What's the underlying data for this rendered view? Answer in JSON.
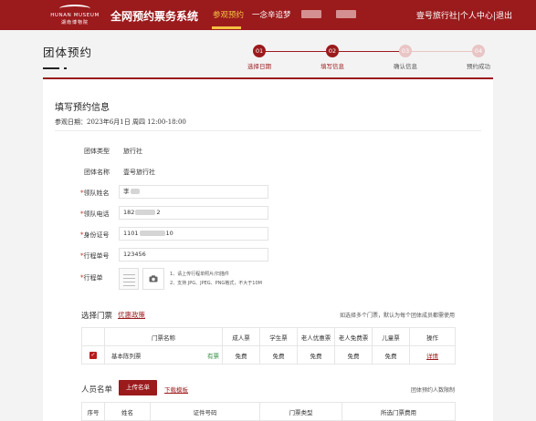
{
  "header": {
    "logo_en": "HUNAN MUSEUM",
    "logo_cn": "湖南博物院",
    "site_title": "全网预约票务系统",
    "nav": [
      {
        "label": "参观预约",
        "active": true
      },
      {
        "label": "一念辛追梦",
        "active": false
      }
    ],
    "user_name": "壹号旅行社",
    "separator": "|",
    "user_center": "个人中心",
    "logout": "退出",
    "brand_color": "#9b1a1c",
    "active_color": "#f4c242"
  },
  "page": {
    "title": "团体预约"
  },
  "steps": [
    {
      "number": "01",
      "label": "选择日期",
      "state": "done"
    },
    {
      "number": "02",
      "label": "填写信息",
      "state": "active"
    },
    {
      "number": "03",
      "label": "确认信息",
      "state": "pending"
    },
    {
      "number": "04",
      "label": "预约成功",
      "state": "pending"
    }
  ],
  "form": {
    "title": "填写预约信息",
    "visit_date": "参观日期：2023年6月1日 周四 12:00-18:00",
    "group_type_label": "团体类型",
    "group_type_value": "旅行社",
    "group_name_label": "团体名称",
    "group_name_value": "壹号旅行社",
    "required_mark": "*",
    "leader_name_label": "领队姓名",
    "leader_name_value": "李",
    "leader_phone_label": "领队电话",
    "leader_phone_prefix": "182",
    "leader_phone_suffix": "2",
    "id_label": "身份证号",
    "id_prefix": "1101",
    "id_suffix": "10",
    "itinerary_no_label": "行程单号",
    "itinerary_no_value": "123456",
    "itinerary_label": "行程单",
    "camera_icon": "camera-icon",
    "upload_tip_1": "1、请上传行程单照片/扫描件",
    "upload_tip_2": "2、支持 JPG、JPEG、PNG格式，不大于10M"
  },
  "tickets": {
    "section_label": "选择门票",
    "policy_link": "优惠政策",
    "hint": "如选择多个门票，默认为每个团体成员都需使用",
    "columns": [
      "",
      "门票名称",
      "成人票",
      "学生票",
      "老人优惠票",
      "老人免费票",
      "儿童票",
      "操作"
    ],
    "rows": [
      {
        "checked": true,
        "name": "基本陈列票",
        "status": "有票",
        "adult": "免费",
        "student": "免费",
        "elder_discount": "免费",
        "elder_free": "免费",
        "child": "免费",
        "action": "详情"
      }
    ]
  },
  "people": {
    "section_label": "人员名单",
    "upload_button": "上传名单",
    "download_link": "下载模板",
    "hint": "团体预约人数限制",
    "columns": [
      "序号",
      "姓名",
      "证件号码",
      "门票类型",
      "所选门票费用"
    ]
  }
}
